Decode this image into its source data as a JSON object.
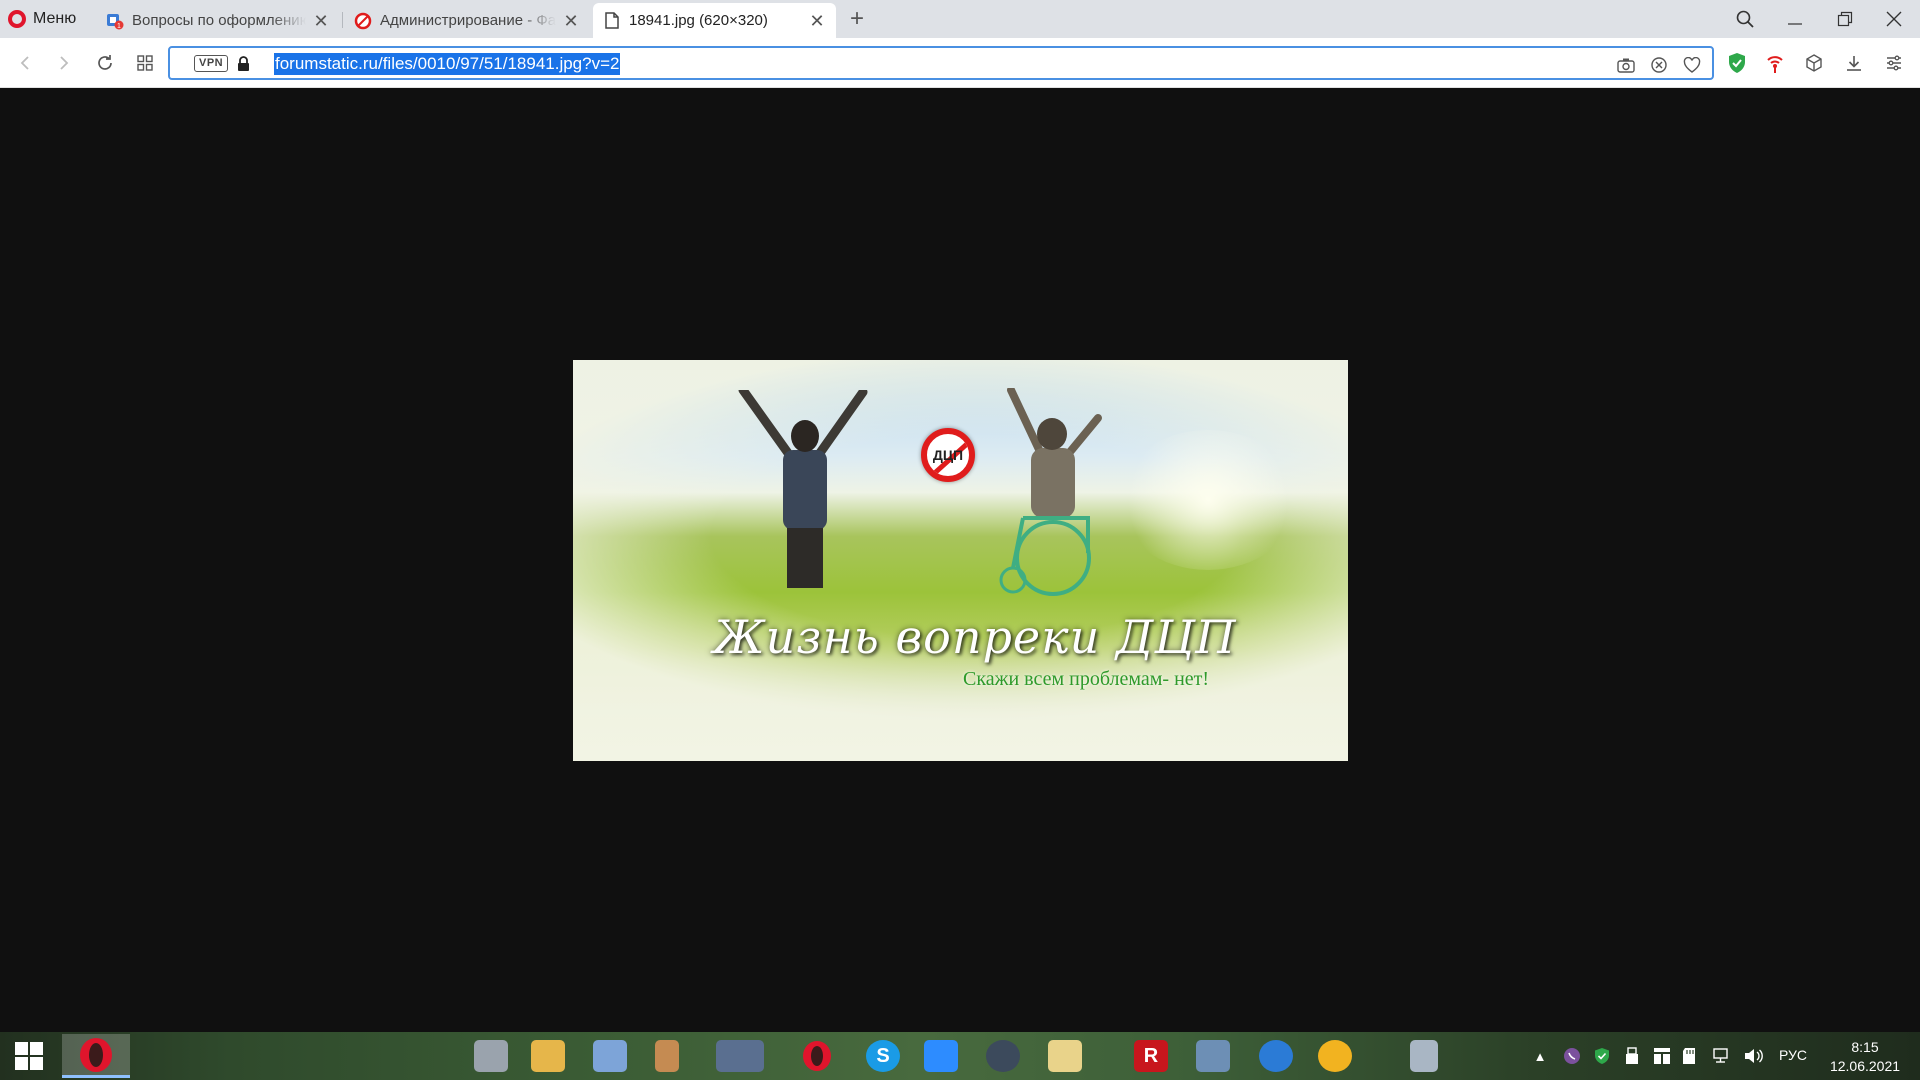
{
  "browser": {
    "menu_label": "Меню",
    "tabs": [
      {
        "title": "Вопросы по оформлению",
        "favicon": "forum-favicon-icon",
        "state": "inactive"
      },
      {
        "title": "Администрирование - Фа",
        "favicon": "no-sign-favicon-icon",
        "state": "inactive"
      },
      {
        "title": "18941.jpg (620×320)",
        "favicon": "file-icon",
        "state": "active"
      }
    ],
    "new_tab_symbol": "+",
    "close_symbol": "✕",
    "address": {
      "vpn_label": "VPN",
      "url": "forumstatic.ru/files/0010/97/51/18941.jpg?v=2"
    }
  },
  "image": {
    "title_text": "Жизнь вопреки ДЦП",
    "subtitle_text": "Скажи всем проблемам- нет!",
    "badge_text": "ДЦП",
    "accent_red": "#e01c1c",
    "accent_green": "#2e9a2a"
  },
  "taskbar": {
    "language": "РУС",
    "time": "8:15",
    "date": "12.06.2021",
    "pinned_letters": {
      "skype": "S",
      "reader": "R"
    }
  }
}
